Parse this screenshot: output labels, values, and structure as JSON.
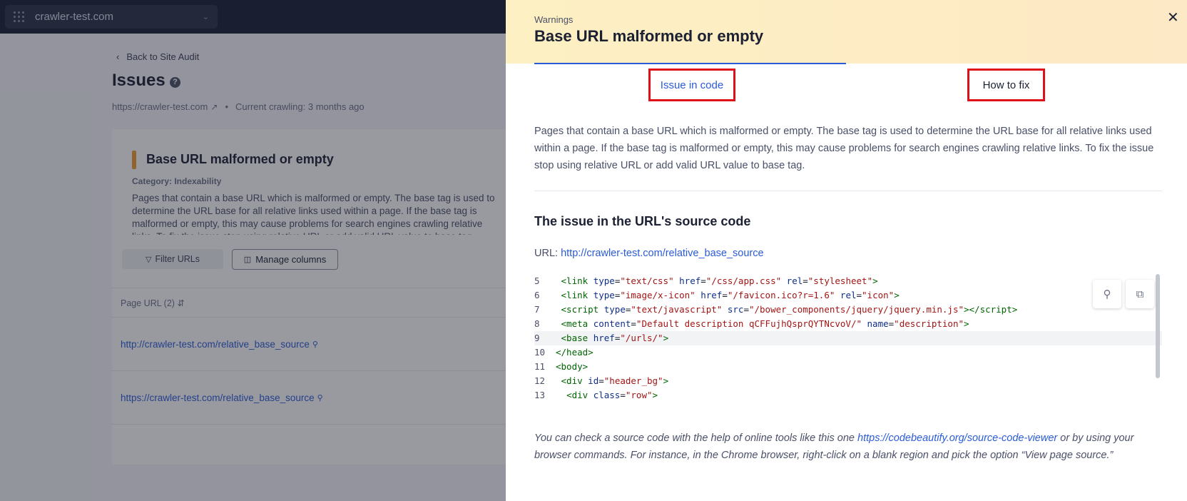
{
  "topbar": {
    "project_name": "crawler-test.com"
  },
  "page": {
    "back_label": "Back to Site Audit",
    "title": "Issues",
    "site_url": "https://crawler-test.com",
    "crawl_status": "Current crawling: 3 months ago",
    "card": {
      "title": "Base URL malformed or empty",
      "category": "Category: Indexability",
      "description": "Pages that contain a base URL which is malformed or empty. The base tag is used to determine the URL base for all relative links used within a page. If the base tag is malformed or empty, this may cause problems for search engines crawling relative links. To fix the issue stop using relative URL or add valid URL value to base tag.",
      "filter_label": "Filter URLs",
      "manage_label": "Manage columns",
      "column_header": "Page URL (2)",
      "rows": [
        "http://crawler-test.com/relative_base_source",
        "https://crawler-test.com/relative_base_source"
      ]
    }
  },
  "drawer": {
    "label": "Warnings",
    "title": "Base URL malformed or empty",
    "tabs": {
      "code": "Issue in code",
      "fix": "How to fix"
    },
    "intro": "Pages that contain a base URL which is malformed or empty. The base tag is used to determine the URL base for all relative links used within a page. If the base tag is malformed or empty, this may cause problems for search engines crawling relative links. To fix the issue stop using relative URL or add valid URL value to base tag.",
    "section_title": "The issue in the URL's source code",
    "url_prefix": "URL:",
    "url": "http://crawler-test.com/relative_base_source",
    "code_lines": [
      {
        "num": "5"
      },
      {
        "num": "6"
      },
      {
        "num": "7"
      },
      {
        "num": "8"
      },
      {
        "num": "9"
      },
      {
        "num": "10"
      },
      {
        "num": "11"
      },
      {
        "num": "12"
      },
      {
        "num": "13"
      }
    ],
    "footer_prefix": "You can check a source code with the help of online tools like this one ",
    "footer_link": "https://codebeautify.org/source-code-viewer",
    "footer_suffix": " or by using your browser commands. For instance, in the Chrome browser, right-click on a blank region and pick the option “View page source.”"
  },
  "icons": {
    "close": "close-icon",
    "search": "search-icon",
    "copy": "copy-icon"
  },
  "colors": {
    "accent": "#2a5bd7",
    "highlight_border": "#e0101a",
    "header_bg": "#fdf0c3",
    "issue_marker": "#ee9b2d"
  }
}
